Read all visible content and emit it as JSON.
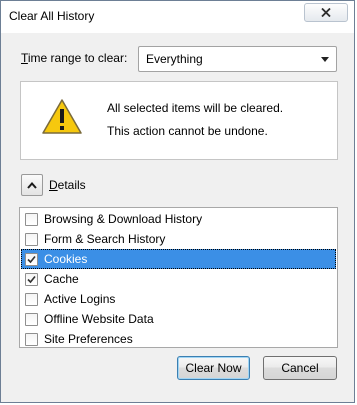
{
  "window": {
    "title": "Clear All History"
  },
  "time_range": {
    "label_prefix": "T",
    "label_rest": "ime range to clear:",
    "selected": "Everything"
  },
  "warning": {
    "line1": "All selected items will be cleared.",
    "line2": "This action cannot be undone."
  },
  "details": {
    "label_prefix": "D",
    "label_rest": "etails"
  },
  "items": [
    {
      "label": "Browsing & Download History",
      "checked": false
    },
    {
      "label": "Form & Search History",
      "checked": false
    },
    {
      "label": "Cookies",
      "checked": true,
      "selected": true
    },
    {
      "label": "Cache",
      "checked": true
    },
    {
      "label": "Active Logins",
      "checked": false
    },
    {
      "label": "Offline Website Data",
      "checked": false
    },
    {
      "label": "Site Preferences",
      "checked": false
    }
  ],
  "buttons": {
    "clear_now": "Clear Now",
    "cancel": "Cancel"
  },
  "colors": {
    "selection": "#3b8fe6",
    "warning_yellow": "#f5c400"
  }
}
